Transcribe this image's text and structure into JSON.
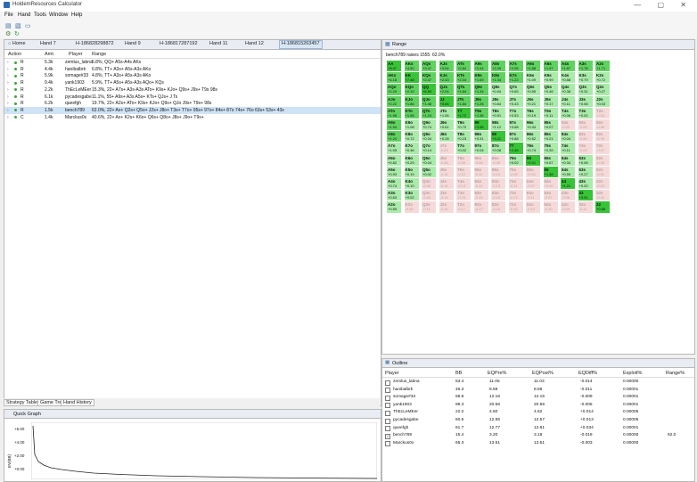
{
  "window": {
    "title": "HoldemResources Calculator",
    "controls": "— ▢ ✕"
  },
  "menu": [
    "File",
    "Hand",
    "Tools",
    "Window",
    "Help"
  ],
  "editor": {
    "tabs": [
      "Home",
      "Hand 7",
      "H-186828298872",
      "Hand 9",
      "H-186817287192",
      "Hand 11",
      "Hand 12",
      "H-186815263457"
    ],
    "columns": [
      "Action",
      "Amt.",
      "Player",
      "Range"
    ],
    "rows": [
      {
        "action": "R",
        "amt": "5.3k",
        "player": "zemlus_labna",
        "range": "5.8%, QQ+ A5s-A4s AKs"
      },
      {
        "action": "R",
        "amt": "4.4k",
        "player": "hanibalbrk",
        "range": "6.8%, TT+ A3s+ A5s-A3s AKo"
      },
      {
        "action": "R",
        "amt": "5.9k",
        "player": "somage#33",
        "range": "4.8%, TT+ A3s+ A5s-A3s AKo"
      },
      {
        "action": "R",
        "amt": "9.4k",
        "player": "yank1903",
        "range": "5.9%, TT+ A5s+ A5s-A3s AQo+ KQs"
      },
      {
        "action": "R",
        "amt": "2.2k",
        "player": "ThEcLeMEer",
        "range": "15.3%, 22+ A7s+ A3s-A3s ATo+ K9s+ KJo+ Q9s+ J9s+ T9s 98s"
      },
      {
        "action": "R",
        "amt": "6.1k",
        "player": "pycadesgabe",
        "range": "11.1%, 55+ A9s+ A3s A5s+ KTs+ QJs+ J Ts"
      },
      {
        "action": "R",
        "amt": "6.2k",
        "player": "queefgh",
        "range": "19.7%, 22+ A2s+ ATo+ K9s+ KJo+ Q9s+ QJo J9s+ T9s+ 98s"
      },
      {
        "action": "R",
        "amt": "1.5k",
        "player": "bench789",
        "range": "62.0%, 22+ Ax+ Q2s+ Q5o+ J2s+ J8o+ T3s+ T7o+ 95s+ 97o+ 84s+ 87o 74s+ 76o 63s+ 53s+ 43s",
        "selected": true
      },
      {
        "action": "C",
        "amt": "1.4k",
        "player": "Marckus0x",
        "range": "40.6%, 22+ Ax+ K2s+ K6o+ Q6s+ Q8o+ J8s+ J9o+ T9s+"
      }
    ],
    "bottom_tabs": [
      "Strategy Table",
      "Game Tree",
      "Hand History"
    ]
  },
  "quick_graph": {
    "title": "Quick Graph",
    "y_labels": [
      "+6.00",
      "+4.00",
      "+2.00",
      "+0.00"
    ],
    "ylabel": "EV(BB)"
  },
  "range": {
    "panel_title": "Range",
    "subtitle": "bench789 raises 1555: 62.0%",
    "grid": [
      [
        [
          "AA",
          "+8.37"
        ],
        [
          "AKs",
          "+4.50"
        ],
        [
          "AQs",
          "+3.47"
        ],
        [
          "AJs",
          "+3.04"
        ],
        [
          "ATs",
          "+2.84"
        ],
        [
          "A9s",
          "+2.44"
        ],
        [
          "A8s",
          "+2.25"
        ],
        [
          "A7s",
          "+2.06"
        ],
        [
          "A6s",
          "+1.88"
        ],
        [
          "A5s",
          "+1.97"
        ],
        [
          "A4s",
          "+1.87"
        ],
        [
          "A3s",
          "+1.78"
        ],
        [
          "A2s",
          "+1.71"
        ]
      ],
      [
        [
          "AKo",
          "+4.18"
        ],
        [
          "KK",
          "+7.48"
        ],
        [
          "KQs",
          "+2.47"
        ],
        [
          "KJs",
          "+2.43"
        ],
        [
          "KTs",
          "+2.04"
        ],
        [
          "K9s",
          "+1.69"
        ],
        [
          "K8s",
          "+1.34"
        ],
        [
          "K7s",
          "+1.22"
        ],
        [
          "K6s",
          "+1.09"
        ],
        [
          "K5s",
          "+0.99"
        ],
        [
          "K4s",
          "+0.88"
        ],
        [
          "K3s",
          "+0.79"
        ],
        [
          "K2s",
          "+0.72"
        ]
      ],
      [
        [
          "AQo",
          "+2.29"
        ],
        [
          "KQo",
          "+2.19"
        ],
        [
          "QQ",
          "+6.59"
        ],
        [
          "QJs",
          "+2.04"
        ],
        [
          "QTs",
          "+1.84"
        ],
        [
          "Q9s",
          "+1.34"
        ],
        [
          "Q8s",
          "+0.94"
        ],
        [
          "Q7s",
          "+0.65"
        ],
        [
          "Q6s",
          "+0.55"
        ],
        [
          "Q5s",
          "+0.46"
        ],
        [
          "Q4s",
          "+0.38"
        ],
        [
          "Q3s",
          "+0.31"
        ],
        [
          "Q2s",
          "+0.27"
        ]
      ],
      [
        [
          "AJo",
          "+2.22"
        ],
        [
          "KJo",
          "+1.86"
        ],
        [
          "QJo",
          "+1.48"
        ],
        [
          "JJ",
          "+5.64"
        ],
        [
          "JTs",
          "+1.84"
        ],
        [
          "J9s",
          "+1.26"
        ],
        [
          "J8s",
          "+0.84"
        ],
        [
          "J7s",
          "+0.43"
        ],
        [
          "J6s",
          "+0.21"
        ],
        [
          "J5s",
          "+0.17"
        ],
        [
          "J4s",
          "+0.11"
        ],
        [
          "J3s",
          "+0.06"
        ],
        [
          "J2s",
          "+0.03"
        ]
      ],
      [
        [
          "ATo",
          "+1.98"
        ],
        [
          "KTo",
          "+1.58"
        ],
        [
          "QTo",
          "+1.24"
        ],
        [
          "JTo",
          "+1.06"
        ],
        [
          "TT",
          "+4.72"
        ],
        [
          "T9s",
          "+1.36"
        ],
        [
          "T8s",
          "+0.91"
        ],
        [
          "T7s",
          "+0.53"
        ],
        [
          "T6s",
          "+0.19"
        ],
        [
          "T5s",
          "+0.11"
        ],
        [
          "T4s",
          "+0.06"
        ],
        [
          "T3s",
          "+0.02"
        ],
        [
          "T2s",
          "-0.04"
        ]
      ],
      [
        [
          "A9o",
          "+1.54"
        ],
        [
          "K9o",
          "+1.08"
        ],
        [
          "Q9o",
          "+0.74"
        ],
        [
          "J9o",
          "+0.61"
        ],
        [
          "T9o",
          "+0.70"
        ],
        [
          "99",
          "+3.96"
        ],
        [
          "98s",
          "+1.12"
        ],
        [
          "97s",
          "+0.68"
        ],
        [
          "96s",
          "+0.34"
        ],
        [
          "95s",
          "+0.07"
        ],
        [
          "94s",
          "-0.02"
        ],
        [
          "93s",
          "-0.05"
        ],
        [
          "92s",
          "-0.08"
        ]
      ],
      [
        [
          "A8o",
          "+1.24"
        ],
        [
          "K8o",
          "+0.72"
        ],
        [
          "Q8o",
          "+0.34"
        ],
        [
          "J8o",
          "+0.28"
        ],
        [
          "T8o",
          "+0.23"
        ],
        [
          "98o",
          "+0.31"
        ],
        [
          "88",
          "+3.21"
        ],
        [
          "87s",
          "+0.88"
        ],
        [
          "86s",
          "+0.52"
        ],
        [
          "85s",
          "+0.21"
        ],
        [
          "84s",
          "+0.04"
        ],
        [
          "83s",
          "-0.06"
        ],
        [
          "82s",
          "-0.09"
        ]
      ],
      [
        [
          "A7o",
          "+1.05"
        ],
        [
          "K7o",
          "+0.46"
        ],
        [
          "Q7o",
          "+0.14"
        ],
        [
          "J7o",
          "-0.03"
        ],
        [
          "T7o",
          "+0.02"
        ],
        [
          "97o",
          "+0.04"
        ],
        [
          "87o",
          "+0.08"
        ],
        [
          "77",
          "+2.46"
        ],
        [
          "76s",
          "+0.74"
        ],
        [
          "75s",
          "+0.39"
        ],
        [
          "74s",
          "+0.11"
        ],
        [
          "73s",
          "-0.03"
        ],
        [
          "72s",
          "-0.07"
        ]
      ],
      [
        [
          "A6o",
          "+0.82"
        ],
        [
          "K6o",
          "+0.29"
        ],
        [
          "Q6o",
          "+0.04"
        ],
        [
          "J6o",
          "-0.08"
        ],
        [
          "T6o",
          "-0.09"
        ],
        [
          "96o",
          "-0.08"
        ],
        [
          "86o",
          "-0.05"
        ],
        [
          "76o",
          "+0.02"
        ],
        [
          "66",
          "+2.01"
        ],
        [
          "65s",
          "+0.67"
        ],
        [
          "64s",
          "+0.34"
        ],
        [
          "63s",
          "+0.06"
        ],
        [
          "62s",
          "-0.05"
        ]
      ],
      [
        [
          "A5o",
          "+0.93"
        ],
        [
          "K5o",
          "+0.19"
        ],
        [
          "Q5o",
          "+0.02"
        ],
        [
          "J5o",
          "-0.10"
        ],
        [
          "T5o",
          "-0.12"
        ],
        [
          "95o",
          "-0.11"
        ],
        [
          "85o",
          "-0.10"
        ],
        [
          "75o",
          "-0.06"
        ],
        [
          "65o",
          "+0.01"
        ],
        [
          "55",
          "+1.58"
        ],
        [
          "54s",
          "+0.59"
        ],
        [
          "53s",
          "+0.27"
        ],
        [
          "52s",
          "-0.01"
        ]
      ],
      [
        [
          "A4o",
          "+0.74"
        ],
        [
          "K4o",
          "+0.10"
        ],
        [
          "Q4o",
          "-0.06"
        ],
        [
          "J4o",
          "-0.12"
        ],
        [
          "T4o",
          "-0.14"
        ],
        [
          "94o",
          "-0.14"
        ],
        [
          "84o",
          "-0.13"
        ],
        [
          "74o",
          "-0.11"
        ],
        [
          "64o",
          "-0.07"
        ],
        [
          "54o",
          "+0.00"
        ],
        [
          "44",
          "+1.21"
        ],
        [
          "43s",
          "+0.20"
        ],
        [
          "42s",
          "-0.02"
        ]
      ],
      [
        [
          "A3o",
          "+0.63"
        ],
        [
          "K3o",
          "+0.02"
        ],
        [
          "Q3o",
          "-0.09"
        ],
        [
          "J3o",
          "-0.14"
        ],
        [
          "T3o",
          "-0.15"
        ],
        [
          "93o",
          "-0.15"
        ],
        [
          "83o",
          "-0.15"
        ],
        [
          "73o",
          "-0.13"
        ],
        [
          "63o",
          "-0.11"
        ],
        [
          "53o",
          "-0.07"
        ],
        [
          "43o",
          "-0.06"
        ],
        [
          "33",
          "+0.91"
        ],
        [
          "32s",
          "-0.04"
        ]
      ],
      [
        [
          "A2o",
          "+0.55"
        ],
        [
          "K2o",
          "-0.04"
        ],
        [
          "Q2o",
          "-0.11"
        ],
        [
          "J2o",
          "-0.15"
        ],
        [
          "T2o",
          "-0.17"
        ],
        [
          "92o",
          "-0.17"
        ],
        [
          "82o",
          "-0.16"
        ],
        [
          "72o",
          "-0.15"
        ],
        [
          "62o",
          "-0.13"
        ],
        [
          "52o",
          "-0.10"
        ],
        [
          "42o",
          "-0.09"
        ],
        [
          "32o",
          "-0.11"
        ],
        [
          "22",
          "+0.66"
        ]
      ]
    ],
    "selected_grid": [
      [
        1,
        1,
        1,
        1,
        1,
        1,
        1,
        1,
        1,
        1,
        1,
        1,
        1
      ],
      [
        1,
        1,
        1,
        1,
        1,
        1,
        1,
        1,
        1,
        1,
        1,
        1,
        1
      ],
      [
        1,
        1,
        1,
        1,
        1,
        1,
        1,
        1,
        1,
        1,
        1,
        1,
        1
      ],
      [
        1,
        1,
        1,
        1,
        1,
        1,
        1,
        1,
        1,
        1,
        1,
        1,
        1
      ],
      [
        1,
        1,
        1,
        1,
        1,
        1,
        1,
        1,
        1,
        1,
        1,
        1,
        0
      ],
      [
        1,
        1,
        1,
        1,
        1,
        1,
        1,
        1,
        1,
        1,
        0,
        0,
        0
      ],
      [
        1,
        1,
        1,
        1,
        1,
        1,
        1,
        1,
        1,
        1,
        1,
        0,
        0
      ],
      [
        1,
        1,
        1,
        0,
        1,
        1,
        1,
        1,
        1,
        1,
        1,
        0,
        0
      ],
      [
        1,
        1,
        1,
        0,
        0,
        0,
        0,
        1,
        1,
        1,
        1,
        1,
        0
      ],
      [
        1,
        1,
        1,
        0,
        0,
        0,
        0,
        0,
        0,
        1,
        1,
        1,
        0
      ],
      [
        1,
        1,
        0,
        0,
        0,
        0,
        0,
        0,
        0,
        0,
        1,
        1,
        0
      ],
      [
        1,
        1,
        0,
        0,
        0,
        0,
        0,
        0,
        0,
        0,
        0,
        1,
        0
      ],
      [
        1,
        0,
        0,
        0,
        0,
        0,
        0,
        0,
        0,
        0,
        0,
        0,
        1
      ]
    ],
    "colors": {
      "selected_strong": "#5fd35f",
      "selected_light": "#a9eba9",
      "unselected": "#f6dada",
      "pair_strong": "#37c437"
    }
  },
  "outline": {
    "title": "Outline",
    "columns": [
      "Player",
      "BB",
      "EQPre%",
      "EQPost%",
      "EQDiff%",
      "Exploit%",
      "Range%"
    ],
    "rows": [
      {
        "checked": false,
        "player": "zemlus_labna",
        "bb": "53.4",
        "pre": "11.05",
        "post": "11.03",
        "diff": "-0.014",
        "exploit": "0.00000",
        "range": ""
      },
      {
        "checked": false,
        "player": "hanibalbrk",
        "bb": "46.3",
        "pre": "8.59",
        "post": "8.58",
        "diff": "-0.011",
        "exploit": "0.00001",
        "range": ""
      },
      {
        "checked": false,
        "player": "somage#33",
        "bb": "58.8",
        "pre": "12.16",
        "post": "12.15",
        "diff": "-0.009",
        "exploit": "0.00001",
        "range": ""
      },
      {
        "checked": false,
        "player": "yank1903",
        "bb": "99.3",
        "pre": "20.56",
        "post": "20.56",
        "diff": "-0.005",
        "exploit": "0.00001",
        "range": ""
      },
      {
        "checked": false,
        "player": "ThEcLeMEer",
        "bb": "22.2",
        "pre": "4.60",
        "post": "4.62",
        "diff": "+0.014",
        "exploit": "0.00005",
        "range": ""
      },
      {
        "checked": false,
        "player": "pycadesgabe",
        "bb": "60.6",
        "pre": "12.55",
        "post": "12.57",
        "diff": "+0.013",
        "exploit": "0.00005",
        "range": ""
      },
      {
        "checked": false,
        "player": "queefgh",
        "bb": "61.7",
        "pre": "12.77",
        "post": "12.81",
        "diff": "+0.034",
        "exploit": "0.00001",
        "range": ""
      },
      {
        "checked": true,
        "player": "bench789",
        "bb": "15.4",
        "pre": "3.20",
        "post": "3.18",
        "diff": "-0.019",
        "exploit": "0.00000",
        "range": "62.0"
      },
      {
        "checked": false,
        "player": "Marckus0x",
        "bb": "65.3",
        "pre": "13.51",
        "post": "13.51",
        "diff": "-0.003",
        "exploit": "0.00000",
        "range": ""
      }
    ]
  }
}
